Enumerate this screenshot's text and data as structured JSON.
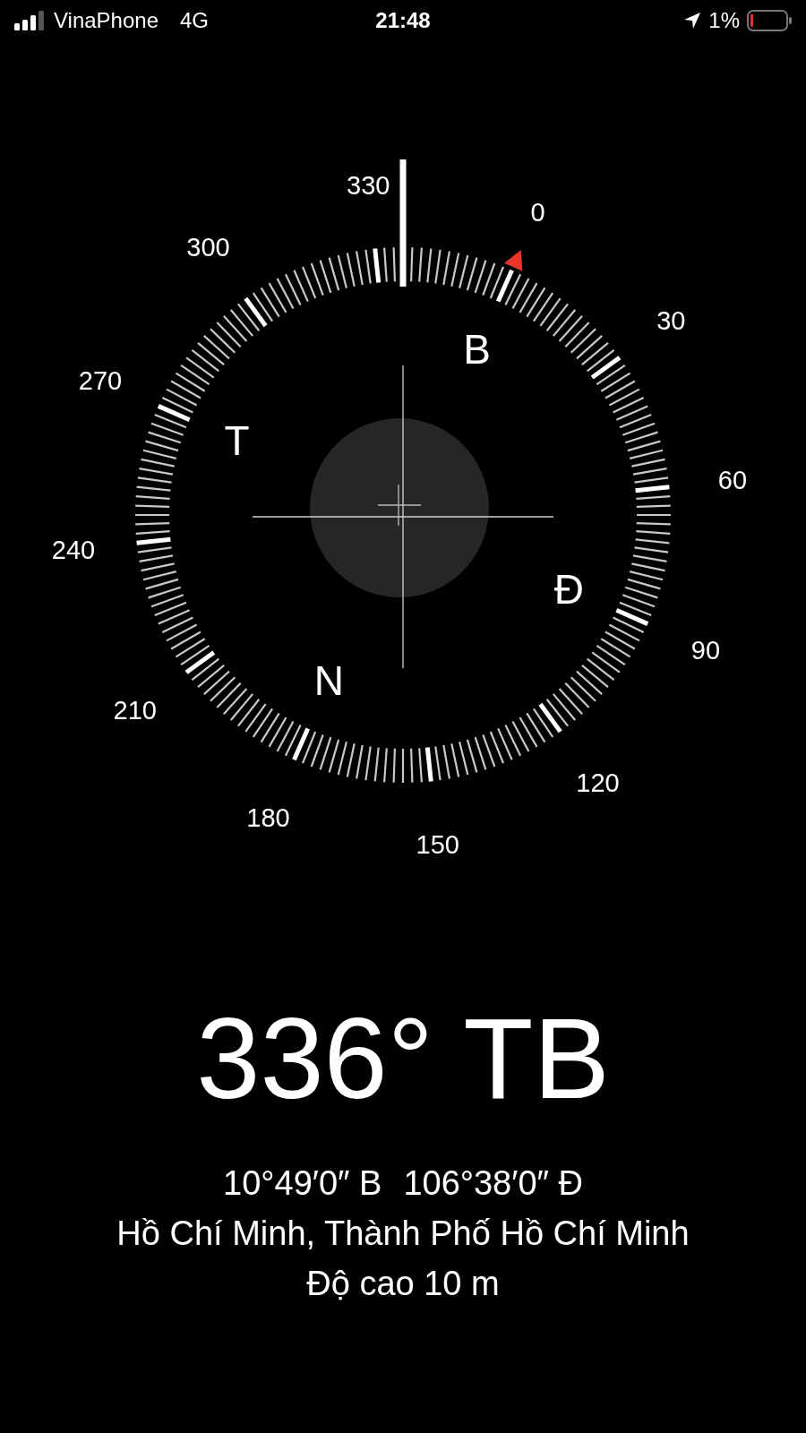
{
  "status_bar": {
    "carrier": "VinaPhone",
    "network": "4G",
    "time": "21:48",
    "battery_percent": "1%"
  },
  "compass": {
    "dial_labels": [
      "0",
      "30",
      "60",
      "90",
      "120",
      "150",
      "180",
      "210",
      "240",
      "270",
      "300",
      "330"
    ],
    "cardinal_letters": [
      "B",
      "Đ",
      "N",
      "T"
    ]
  },
  "heading": "336° TB",
  "latitude": "10°49′0″ B",
  "longitude": "106°38′0″ Đ",
  "location": "Hồ Chí Minh, Thành Phố Hồ Chí Minh",
  "altitude": "Độ cao 10 m"
}
